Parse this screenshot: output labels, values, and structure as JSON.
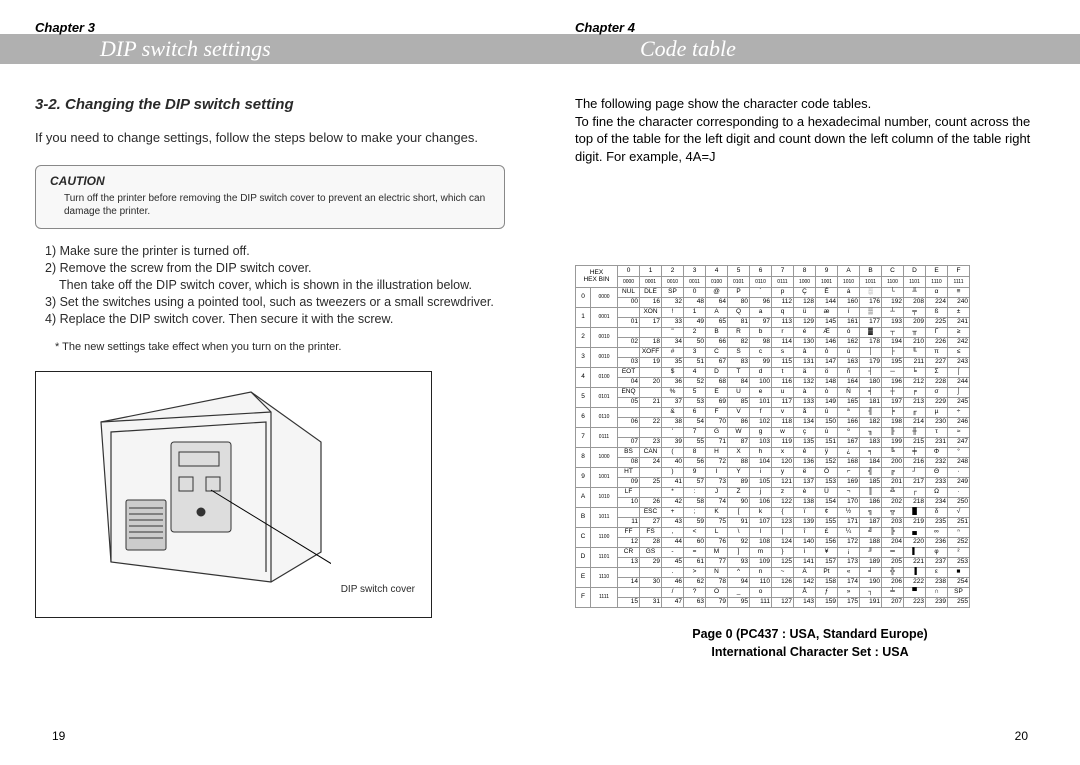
{
  "left": {
    "chapter": "Chapter 3",
    "title": "DIP switch settings",
    "section_heading": "3-2. Changing the DIP switch setting",
    "intro": "If you need to change settings, follow the steps below to make your changes.",
    "caution_heading": "CAUTION",
    "caution_text": "Turn off the printer before removing the DIP switch cover to prevent an electric short, which can damage the printer.",
    "steps": {
      "s1": "1) Make sure the printer is turned off.",
      "s2": "2) Remove the screw from the DIP switch cover.",
      "s2b": "Then take off the DIP switch cover, which is shown in the illustration below.",
      "s3": "3) Set the switches using a pointed tool, such as tweezers or a small screwdriver.",
      "s4": "4) Replace the DIP switch cover. Then secure it with the screw."
    },
    "note": "* The new settings take effect when you turn on the printer.",
    "illus_label": "DIP switch cover",
    "page_num": "19"
  },
  "right": {
    "chapter": "Chapter 4",
    "title": "Code table",
    "intro_l1": "The following page show the character code tables.",
    "intro_l2": "To fine the character corresponding to a hexadecimal number, count across the top of the table for the left digit and count down the left column of the table right digit. For example, 4A=J",
    "page_num": "20",
    "caption_l1": "Page 0 (PC437 : USA, Standard Europe)",
    "caption_l2": "International Character Set : USA"
  },
  "code_table": {
    "hex_cols": [
      "0",
      "1",
      "2",
      "3",
      "4",
      "5",
      "6",
      "7",
      "8",
      "9",
      "A",
      "B",
      "C",
      "D",
      "E",
      "F"
    ],
    "bin_cols": [
      "0000",
      "0001",
      "0010",
      "0011",
      "0100",
      "0101",
      "0110",
      "0111",
      "1000",
      "1001",
      "1010",
      "1011",
      "1100",
      "1101",
      "1110",
      "1111"
    ],
    "rows": [
      {
        "hex": "0",
        "bin": "0000",
        "cells": [
          [
            "NUL",
            "00"
          ],
          [
            "DLE",
            "16"
          ],
          [
            "SP",
            "32"
          ],
          [
            "0",
            "48"
          ],
          [
            "@",
            "64"
          ],
          [
            "P",
            "80"
          ],
          [
            "`",
            "96"
          ],
          [
            "p",
            "112"
          ],
          [
            "Ç",
            "128"
          ],
          [
            "É",
            "144"
          ],
          [
            "á",
            "160"
          ],
          [
            "░",
            "176"
          ],
          [
            "└",
            "192"
          ],
          [
            "╨",
            "208"
          ],
          [
            "α",
            "224"
          ],
          [
            "≡",
            "240"
          ]
        ]
      },
      {
        "hex": "1",
        "bin": "0001",
        "cells": [
          [
            "",
            "01"
          ],
          [
            "XON",
            "17"
          ],
          [
            "!",
            "33"
          ],
          [
            "1",
            "49"
          ],
          [
            "A",
            "65"
          ],
          [
            "Q",
            "81"
          ],
          [
            "a",
            "97"
          ],
          [
            "q",
            "113"
          ],
          [
            "ü",
            "129"
          ],
          [
            "æ",
            "145"
          ],
          [
            "í",
            "161"
          ],
          [
            "▒",
            "177"
          ],
          [
            "┴",
            "193"
          ],
          [
            "╤",
            "209"
          ],
          [
            "ß",
            "225"
          ],
          [
            "±",
            "241"
          ]
        ]
      },
      {
        "hex": "2",
        "bin": "0010",
        "cells": [
          [
            "",
            "02"
          ],
          [
            "",
            "18"
          ],
          [
            "\"",
            "34"
          ],
          [
            "2",
            "50"
          ],
          [
            "B",
            "66"
          ],
          [
            "R",
            "82"
          ],
          [
            "b",
            "98"
          ],
          [
            "r",
            "114"
          ],
          [
            "é",
            "130"
          ],
          [
            "Æ",
            "146"
          ],
          [
            "ó",
            "162"
          ],
          [
            "▓",
            "178"
          ],
          [
            "┬",
            "194"
          ],
          [
            "╥",
            "210"
          ],
          [
            "Γ",
            "226"
          ],
          [
            "≥",
            "242"
          ]
        ]
      },
      {
        "hex": "3",
        "bin": "0010",
        "cells": [
          [
            "",
            "03"
          ],
          [
            "XOFF",
            "19"
          ],
          [
            "#",
            "35"
          ],
          [
            "3",
            "51"
          ],
          [
            "C",
            "67"
          ],
          [
            "S",
            "83"
          ],
          [
            "c",
            "99"
          ],
          [
            "s",
            "115"
          ],
          [
            "â",
            "131"
          ],
          [
            "ô",
            "147"
          ],
          [
            "ú",
            "163"
          ],
          [
            "│",
            "179"
          ],
          [
            "├",
            "195"
          ],
          [
            "╙",
            "211"
          ],
          [
            "π",
            "227"
          ],
          [
            "≤",
            "243"
          ]
        ]
      },
      {
        "hex": "4",
        "bin": "0100",
        "cells": [
          [
            "EOT",
            "04"
          ],
          [
            "",
            "20"
          ],
          [
            "$",
            "36"
          ],
          [
            "4",
            "52"
          ],
          [
            "D",
            "68"
          ],
          [
            "T",
            "84"
          ],
          [
            "d",
            "100"
          ],
          [
            "t",
            "116"
          ],
          [
            "ä",
            "132"
          ],
          [
            "ö",
            "148"
          ],
          [
            "ñ",
            "164"
          ],
          [
            "┤",
            "180"
          ],
          [
            "─",
            "196"
          ],
          [
            "╘",
            "212"
          ],
          [
            "Σ",
            "228"
          ],
          [
            "⌠",
            "244"
          ]
        ]
      },
      {
        "hex": "5",
        "bin": "0101",
        "cells": [
          [
            "ENQ",
            "05"
          ],
          [
            "",
            "21"
          ],
          [
            "%",
            "37"
          ],
          [
            "5",
            "53"
          ],
          [
            "E",
            "69"
          ],
          [
            "U",
            "85"
          ],
          [
            "e",
            "101"
          ],
          [
            "u",
            "117"
          ],
          [
            "à",
            "133"
          ],
          [
            "ò",
            "149"
          ],
          [
            "Ñ",
            "165"
          ],
          [
            "╡",
            "181"
          ],
          [
            "┼",
            "197"
          ],
          [
            "╒",
            "213"
          ],
          [
            "σ",
            "229"
          ],
          [
            "⌡",
            "245"
          ]
        ]
      },
      {
        "hex": "6",
        "bin": "0110",
        "cells": [
          [
            "",
            "06"
          ],
          [
            "",
            "22"
          ],
          [
            "&",
            "38"
          ],
          [
            "6",
            "54"
          ],
          [
            "F",
            "70"
          ],
          [
            "V",
            "86"
          ],
          [
            "f",
            "102"
          ],
          [
            "v",
            "118"
          ],
          [
            "å",
            "134"
          ],
          [
            "û",
            "150"
          ],
          [
            "ª",
            "166"
          ],
          [
            "╢",
            "182"
          ],
          [
            "╞",
            "198"
          ],
          [
            "╓",
            "214"
          ],
          [
            "µ",
            "230"
          ],
          [
            "÷",
            "246"
          ]
        ]
      },
      {
        "hex": "7",
        "bin": "0111",
        "cells": [
          [
            "",
            "07"
          ],
          [
            "",
            "23"
          ],
          [
            "'",
            "39"
          ],
          [
            "7",
            "55"
          ],
          [
            "G",
            "71"
          ],
          [
            "W",
            "87"
          ],
          [
            "g",
            "103"
          ],
          [
            "w",
            "119"
          ],
          [
            "ç",
            "135"
          ],
          [
            "ù",
            "151"
          ],
          [
            "º",
            "167"
          ],
          [
            "╖",
            "183"
          ],
          [
            "╟",
            "199"
          ],
          [
            "╫",
            "215"
          ],
          [
            "τ",
            "231"
          ],
          [
            "≈",
            "247"
          ]
        ]
      },
      {
        "hex": "8",
        "bin": "1000",
        "cells": [
          [
            "BS",
            "08"
          ],
          [
            "CAN",
            "24"
          ],
          [
            "(",
            "40"
          ],
          [
            "8",
            "56"
          ],
          [
            "H",
            "72"
          ],
          [
            "X",
            "88"
          ],
          [
            "h",
            "104"
          ],
          [
            "x",
            "120"
          ],
          [
            "ê",
            "136"
          ],
          [
            "ÿ",
            "152"
          ],
          [
            "¿",
            "168"
          ],
          [
            "╕",
            "184"
          ],
          [
            "╚",
            "200"
          ],
          [
            "╪",
            "216"
          ],
          [
            "Φ",
            "232"
          ],
          [
            "°",
            "248"
          ]
        ]
      },
      {
        "hex": "9",
        "bin": "1001",
        "cells": [
          [
            "HT",
            "09"
          ],
          [
            "",
            "25"
          ],
          [
            ")",
            "41"
          ],
          [
            "9",
            "57"
          ],
          [
            "I",
            "73"
          ],
          [
            "Y",
            "89"
          ],
          [
            "i",
            "105"
          ],
          [
            "y",
            "121"
          ],
          [
            "ë",
            "137"
          ],
          [
            "Ö",
            "153"
          ],
          [
            "⌐",
            "169"
          ],
          [
            "╣",
            "185"
          ],
          [
            "╔",
            "201"
          ],
          [
            "┘",
            "217"
          ],
          [
            "Θ",
            "233"
          ],
          [
            "∙",
            "249"
          ]
        ]
      },
      {
        "hex": "A",
        "bin": "1010",
        "cells": [
          [
            "LF",
            "10"
          ],
          [
            "",
            "26"
          ],
          [
            "*",
            "42"
          ],
          [
            ":",
            "58"
          ],
          [
            "J",
            "74"
          ],
          [
            "Z",
            "90"
          ],
          [
            "j",
            "106"
          ],
          [
            "z",
            "122"
          ],
          [
            "è",
            "138"
          ],
          [
            "Ü",
            "154"
          ],
          [
            "¬",
            "170"
          ],
          [
            "║",
            "186"
          ],
          [
            "╩",
            "202"
          ],
          [
            "┌",
            "218"
          ],
          [
            "Ω",
            "234"
          ],
          [
            "·",
            "250"
          ]
        ]
      },
      {
        "hex": "B",
        "bin": "1011",
        "cells": [
          [
            "",
            "11"
          ],
          [
            "ESC",
            "27"
          ],
          [
            "+",
            "43"
          ],
          [
            ";",
            "59"
          ],
          [
            "K",
            "75"
          ],
          [
            "[",
            "91"
          ],
          [
            "k",
            "107"
          ],
          [
            "{",
            "123"
          ],
          [
            "ï",
            "139"
          ],
          [
            "¢",
            "155"
          ],
          [
            "½",
            "171"
          ],
          [
            "╗",
            "187"
          ],
          [
            "╦",
            "203"
          ],
          [
            "█",
            "219"
          ],
          [
            "δ",
            "235"
          ],
          [
            "√",
            "251"
          ]
        ]
      },
      {
        "hex": "C",
        "bin": "1100",
        "cells": [
          [
            "FF",
            "12"
          ],
          [
            "FS",
            "28"
          ],
          [
            ",",
            "44"
          ],
          [
            "<",
            "60"
          ],
          [
            "L",
            "76"
          ],
          [
            "\\",
            "92"
          ],
          [
            "l",
            "108"
          ],
          [
            "|",
            "124"
          ],
          [
            "î",
            "140"
          ],
          [
            "£",
            "156"
          ],
          [
            "¼",
            "172"
          ],
          [
            "╝",
            "188"
          ],
          [
            "╠",
            "204"
          ],
          [
            "▄",
            "220"
          ],
          [
            "∞",
            "236"
          ],
          [
            "ⁿ",
            "252"
          ]
        ]
      },
      {
        "hex": "D",
        "bin": "1101",
        "cells": [
          [
            "CR",
            "13"
          ],
          [
            "GS",
            "29"
          ],
          [
            "-",
            "45"
          ],
          [
            "=",
            "61"
          ],
          [
            "M",
            "77"
          ],
          [
            "]",
            "93"
          ],
          [
            "m",
            "109"
          ],
          [
            "}",
            "125"
          ],
          [
            "ì",
            "141"
          ],
          [
            "¥",
            "157"
          ],
          [
            "¡",
            "173"
          ],
          [
            "╜",
            "189"
          ],
          [
            "═",
            "205"
          ],
          [
            "▌",
            "221"
          ],
          [
            "φ",
            "237"
          ],
          [
            "²",
            "253"
          ]
        ]
      },
      {
        "hex": "E",
        "bin": "1110",
        "cells": [
          [
            "",
            "14"
          ],
          [
            "",
            "30"
          ],
          [
            ".",
            "46"
          ],
          [
            ">",
            "62"
          ],
          [
            "N",
            "78"
          ],
          [
            "^",
            "94"
          ],
          [
            "n",
            "110"
          ],
          [
            "~",
            "126"
          ],
          [
            "Ä",
            "142"
          ],
          [
            "Pt",
            "158"
          ],
          [
            "«",
            "174"
          ],
          [
            "╛",
            "190"
          ],
          [
            "╬",
            "206"
          ],
          [
            "▐",
            "222"
          ],
          [
            "ε",
            "238"
          ],
          [
            "■",
            "254"
          ]
        ]
      },
      {
        "hex": "F",
        "bin": "1111",
        "cells": [
          [
            "",
            "15"
          ],
          [
            "",
            "31"
          ],
          [
            "/",
            "47"
          ],
          [
            "?",
            "63"
          ],
          [
            "O",
            "79"
          ],
          [
            "_",
            "95"
          ],
          [
            "o",
            "111"
          ],
          [
            "",
            "127"
          ],
          [
            "Å",
            "143"
          ],
          [
            "ƒ",
            "159"
          ],
          [
            "»",
            "175"
          ],
          [
            "┐",
            "191"
          ],
          [
            "╧",
            "207"
          ],
          [
            "▀",
            "223"
          ],
          [
            "∩",
            "239"
          ],
          [
            "SP",
            "255"
          ]
        ]
      }
    ]
  }
}
